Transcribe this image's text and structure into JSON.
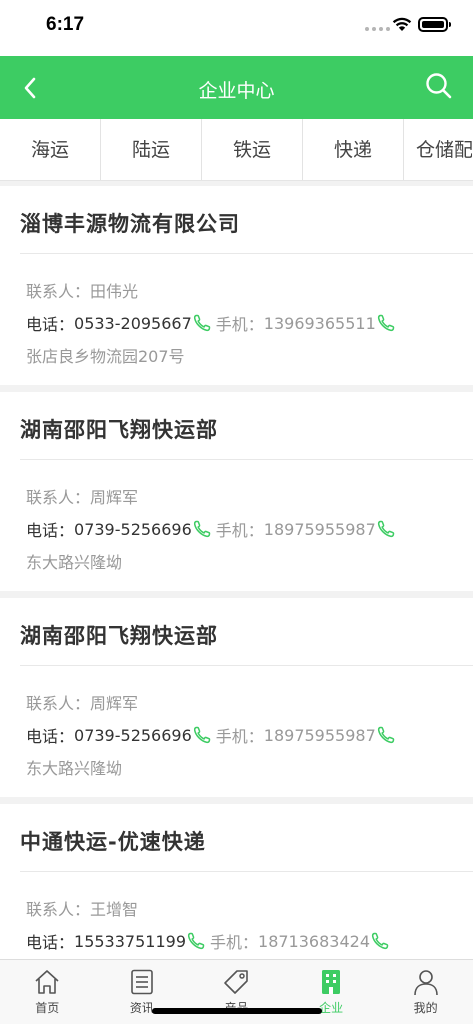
{
  "status_bar": {
    "time": "6:17"
  },
  "nav": {
    "title": "企业中心"
  },
  "colors": {
    "accent": "#3dcc63"
  },
  "tabs": [
    {
      "label": "海运"
    },
    {
      "label": "陆运"
    },
    {
      "label": "铁运"
    },
    {
      "label": "快递"
    },
    {
      "label": "仓储配"
    }
  ],
  "companies": [
    {
      "name": "淄博丰源物流有限公司",
      "contact_label": "联系人：",
      "contact": "田伟光",
      "phone_label": "电话：",
      "phone": "0533-2095667",
      "mobile_label": "手机：",
      "mobile": "13969365511",
      "address": "张店良乡物流园207号"
    },
    {
      "name": "湖南邵阳飞翔快运部",
      "contact_label": "联系人：",
      "contact": "周辉军",
      "phone_label": "电话：",
      "phone": "0739-5256696",
      "mobile_label": "手机：",
      "mobile": "18975955987",
      "address": "东大路兴隆坳"
    },
    {
      "name": "湖南邵阳飞翔快运部",
      "contact_label": "联系人：",
      "contact": "周辉军",
      "phone_label": "电话：",
      "phone": "0739-5256696",
      "mobile_label": "手机：",
      "mobile": "18975955987",
      "address": "东大路兴隆坳"
    },
    {
      "name": "中通快运-优速快递",
      "contact_label": "联系人：",
      "contact": "王增智",
      "phone_label": "电话：",
      "phone": "15533751199",
      "mobile_label": "手机：",
      "mobile": "18713683424",
      "address": ""
    }
  ],
  "tabbar": [
    {
      "label": "首页",
      "icon": "home-icon"
    },
    {
      "label": "资讯",
      "icon": "news-icon"
    },
    {
      "label": "产品",
      "icon": "tag-icon"
    },
    {
      "label": "企业",
      "icon": "building-icon"
    },
    {
      "label": "我的",
      "icon": "person-icon"
    }
  ]
}
